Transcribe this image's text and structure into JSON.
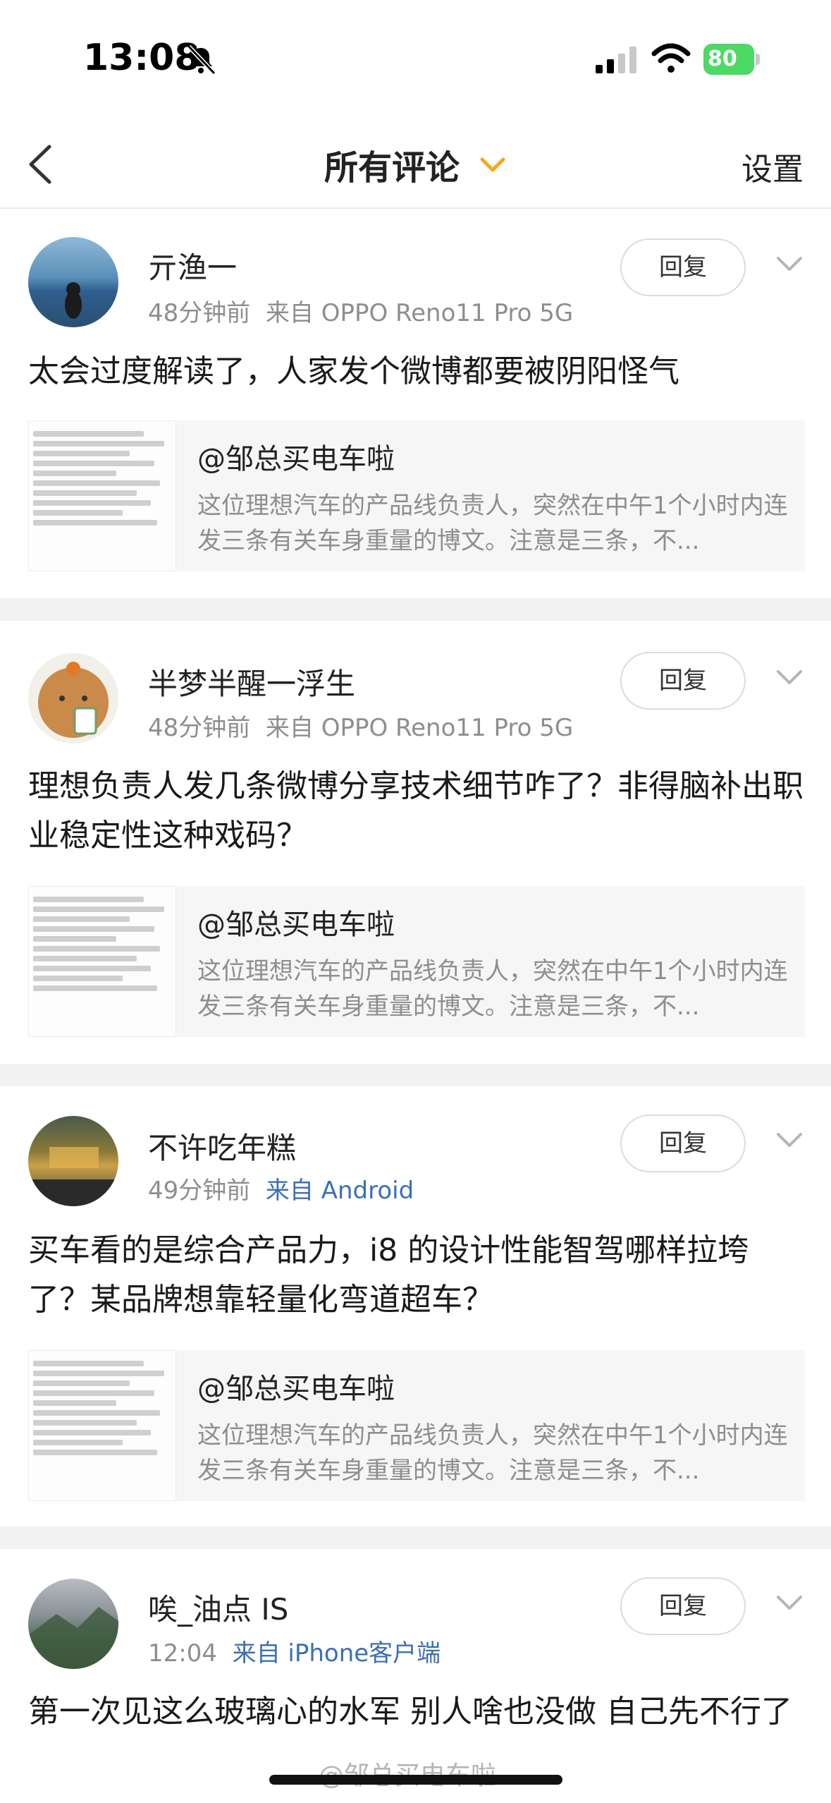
{
  "status_bar": {
    "time": "13:08",
    "battery": "80"
  },
  "nav": {
    "title": "所有评论",
    "settings": "设置"
  },
  "reply_label": "回复",
  "quote": {
    "author": "@邹总买电车啦",
    "snippet": "这位理想汽车的产品线负责人，突然在中午1个小时内连发三条有关车身重量的博文。注意是三条，不..."
  },
  "comments": [
    {
      "username": "亓渔一",
      "time": "48分钟前",
      "source": "来自 OPPO Reno11 Pro 5G",
      "text": "太会过度解读了，人家发个微博都要被阴阳怪气"
    },
    {
      "username": "半梦半醒一浮生",
      "time": "48分钟前",
      "source": "来自 OPPO Reno11 Pro 5G",
      "text": "理想负责人发几条微博分享技术细节咋了？非得脑补出职业稳定性这种戏码？"
    },
    {
      "username": "不许吃年糕",
      "time": "49分钟前",
      "source": "来自 Android",
      "text": "买车看的是综合产品力，i8 的设计性能智驾哪样拉垮了？某品牌想靠轻量化弯道超车？"
    },
    {
      "username": "唉_油点 IS",
      "time": "12:04",
      "source": "来自 iPhone客户端",
      "text": "第一次见这么玻璃心的水军 别人啥也没做 自己先不行了"
    }
  ],
  "watermark": "@邹总买电车啦",
  "colors": {
    "link": "#3b6fb6",
    "accent_orange": "#f5a623",
    "battery_green": "#4cd964",
    "meta_gray": "#8e8e8e"
  }
}
